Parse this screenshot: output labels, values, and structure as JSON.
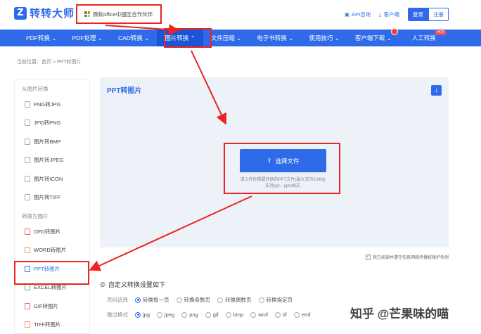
{
  "brand": {
    "logo_letter": "Z",
    "name": "转转大师"
  },
  "partner": {
    "text": "微软office中国区合作伙伴"
  },
  "header": {
    "api": "API咨询",
    "client": "客户端",
    "login": "登录",
    "register": "注册"
  },
  "nav": {
    "items": [
      {
        "label": "PDF转换 ⌄"
      },
      {
        "label": "PDF处理 ⌄"
      },
      {
        "label": "CAD转换 ⌄"
      },
      {
        "label": "图片转换 ⌃"
      },
      {
        "label": "文件压缩 ⌄"
      },
      {
        "label": "电子书转换 ⌄"
      },
      {
        "label": "使用技巧 ⌄"
      },
      {
        "label": "客户端下载 ⌄"
      },
      {
        "label": "人工转换"
      }
    ],
    "hot_badge": "HOT"
  },
  "breadcrumb": "当前位置：首页 > PPT转图片",
  "sidebar": {
    "group1": "从图片转换",
    "items1": [
      "PNG转JPG",
      "JPG转PNG",
      "图片转BMP",
      "图片转JPEG",
      "图片转ICON",
      "图片转TIFF"
    ],
    "group2": "转换为图片",
    "items2": [
      "OFD转图片",
      "WORD转图片",
      "PPT转图片",
      "EXCEL转图片",
      "GIF转图片",
      "TIFF转图片"
    ]
  },
  "upload": {
    "title": "PPT转图片",
    "button": "选择文件",
    "hint1": "请上传你需要转换的PPT文件(最大支持100M)",
    "hint2": "支持ppt、pptx格式"
  },
  "agreement": "我已阅读并遵守信息网络传播权保护条例",
  "settings": {
    "title": "自定义转换设置如下",
    "page_label": "页码选择",
    "page_options": [
      "转换每一页",
      "转换奇数页",
      "转换偶数页",
      "转换指定页"
    ],
    "format_label": "输出格式",
    "format_options": [
      "jpg",
      "jpeg",
      "png",
      "gif",
      "bmp",
      "wmf",
      "tif",
      "emf"
    ]
  },
  "watermark": "知乎 @芒果味的喵",
  "colors": {
    "accent": "#2f6be8",
    "highlight": "#e22222"
  }
}
